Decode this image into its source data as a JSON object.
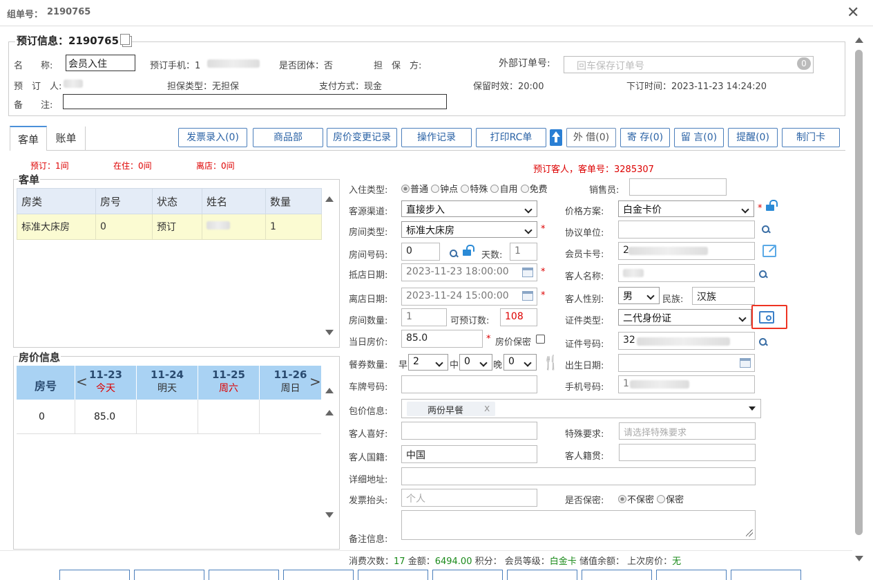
{
  "window": {
    "title_label": "组单号：",
    "title_value": "2190765"
  },
  "booking": {
    "section_title": "预订信息：2190765",
    "name_label": "名　　称:",
    "name_value": "会员入住",
    "phone_label": "预订手机：1",
    "group_label": "是否团体：否",
    "guarantor_label": "担　保　方:",
    "ext_order_label": "外部订单号:",
    "ext_order_placeholder": "回车保存订单号",
    "ext_order_badge": "0",
    "booker_label": "预　订　人:",
    "guarantee_type": "担保类型：无担保",
    "payment": "支付方式：现金",
    "hold_time": "保留时效：20:00",
    "order_time": "下订时间：2023-11-23 14:24:20",
    "remark_label": "备　　注:"
  },
  "tabs": [
    {
      "label": "客单"
    },
    {
      "label": "账单"
    }
  ],
  "toolbar": [
    "发票录入(0)",
    "商品部",
    "房价变更记录",
    "操作记录",
    "打印RC单",
    "外 借(0)",
    "寄 存(0)",
    "留 言(0)",
    "提醒(0)",
    "制门卡"
  ],
  "status": {
    "reserved": "预订：1间",
    "in_house": "在住：0间",
    "departed": "离店：0间",
    "guest_info": "预订客人，客单号：3285307"
  },
  "guest_list": {
    "title": "客单",
    "headers": [
      "房类",
      "房号",
      "状态",
      "姓名",
      "数量"
    ],
    "rows": [
      {
        "type": "标准大床房",
        "room": "0",
        "status": "预订",
        "qty": "1"
      }
    ]
  },
  "rate_info": {
    "title": "房价信息",
    "room_header": "房号",
    "days": [
      {
        "date": "11-23",
        "day": "今天",
        "red": true
      },
      {
        "date": "11-24",
        "day": "明天",
        "red": false
      },
      {
        "date": "11-25",
        "day": "周六",
        "red": true
      },
      {
        "date": "11-26",
        "day": "周日",
        "red": false
      }
    ],
    "rows": [
      {
        "room": "0",
        "price": "85.0"
      }
    ]
  },
  "form": {
    "checkin_type_label": "入住类型:",
    "checkin_types": [
      "普通",
      "钟点",
      "特殊",
      "自用",
      "免费"
    ],
    "sales_label": "销售员:",
    "channel_label": "客源渠道:",
    "channel_value": "直接步入",
    "price_plan_label": "价格方案:",
    "price_plan_value": "白金卡价",
    "room_type_label": "房间类型:",
    "room_type_value": "标准大床房",
    "agreement_label": "协议单位:",
    "room_no_label": "房间号码:",
    "room_no_value": "0",
    "days_label": "天数:",
    "days_value": "1",
    "member_card_label": "会员卡号:",
    "member_card_value": "2",
    "arrive_label": "抵店日期:",
    "arrive_value": "2023-11-23 18:00:00",
    "guest_name_label": "客人名称:",
    "depart_label": "离店日期:",
    "depart_value": "2023-11-24 15:00:00",
    "gender_label": "客人性别:",
    "gender_value": "男",
    "ethnic_label": "民族:",
    "ethnic_value": "汉族",
    "room_count_label": "房间数量:",
    "room_count_value": "1",
    "available_label": "可预订数:",
    "available_value": "108",
    "id_type_label": "证件类型:",
    "id_type_value": "二代身份证",
    "today_price_label": "当日房价:",
    "today_price_value": "85.0",
    "price_secret_label": "房价保密",
    "id_no_label": "证件号码:",
    "id_no_value": "32",
    "meal_label": "餐券数量:",
    "breakfast_label": "早",
    "breakfast_value": "2",
    "lunch_label": "中",
    "lunch_value": "0",
    "dinner_label": "晚",
    "dinner_value": "0",
    "birth_label": "出生日期:",
    "plate_label": "车牌号码:",
    "mobile_label": "手机号码:",
    "mobile_value": "1",
    "package_label": "包价信息:",
    "package_tag": "两份早餐",
    "package_tag_close": "x",
    "preference_label": "客人喜好:",
    "special_label": "特殊要求:",
    "special_placeholder": "请选择特殊要求",
    "nationality_label": "客人国籍:",
    "nationality_value": "中国",
    "origin_label": "客人籍贯:",
    "address_label": "详细地址:",
    "invoice_label": "发票抬头:",
    "invoice_placeholder": "个人",
    "secret_label": "是否保密:",
    "secret_options": [
      "不保密",
      "保密"
    ],
    "note_label": "备注信息:"
  },
  "footer": {
    "visits_label": "消费次数：",
    "visits": "17",
    "amount_label": "金额：",
    "amount": "6494.00",
    "points_label": "积分：",
    "level_label": "会员等级：",
    "level": "白金卡",
    "balance_label": "储值余额：",
    "last_price_label": "上次房价：",
    "last_price": "无"
  },
  "colors": {
    "accent": "#2a62a5",
    "red": "#d00000",
    "green": "#1a8a1a",
    "header_blue": "#a9d2f3"
  }
}
